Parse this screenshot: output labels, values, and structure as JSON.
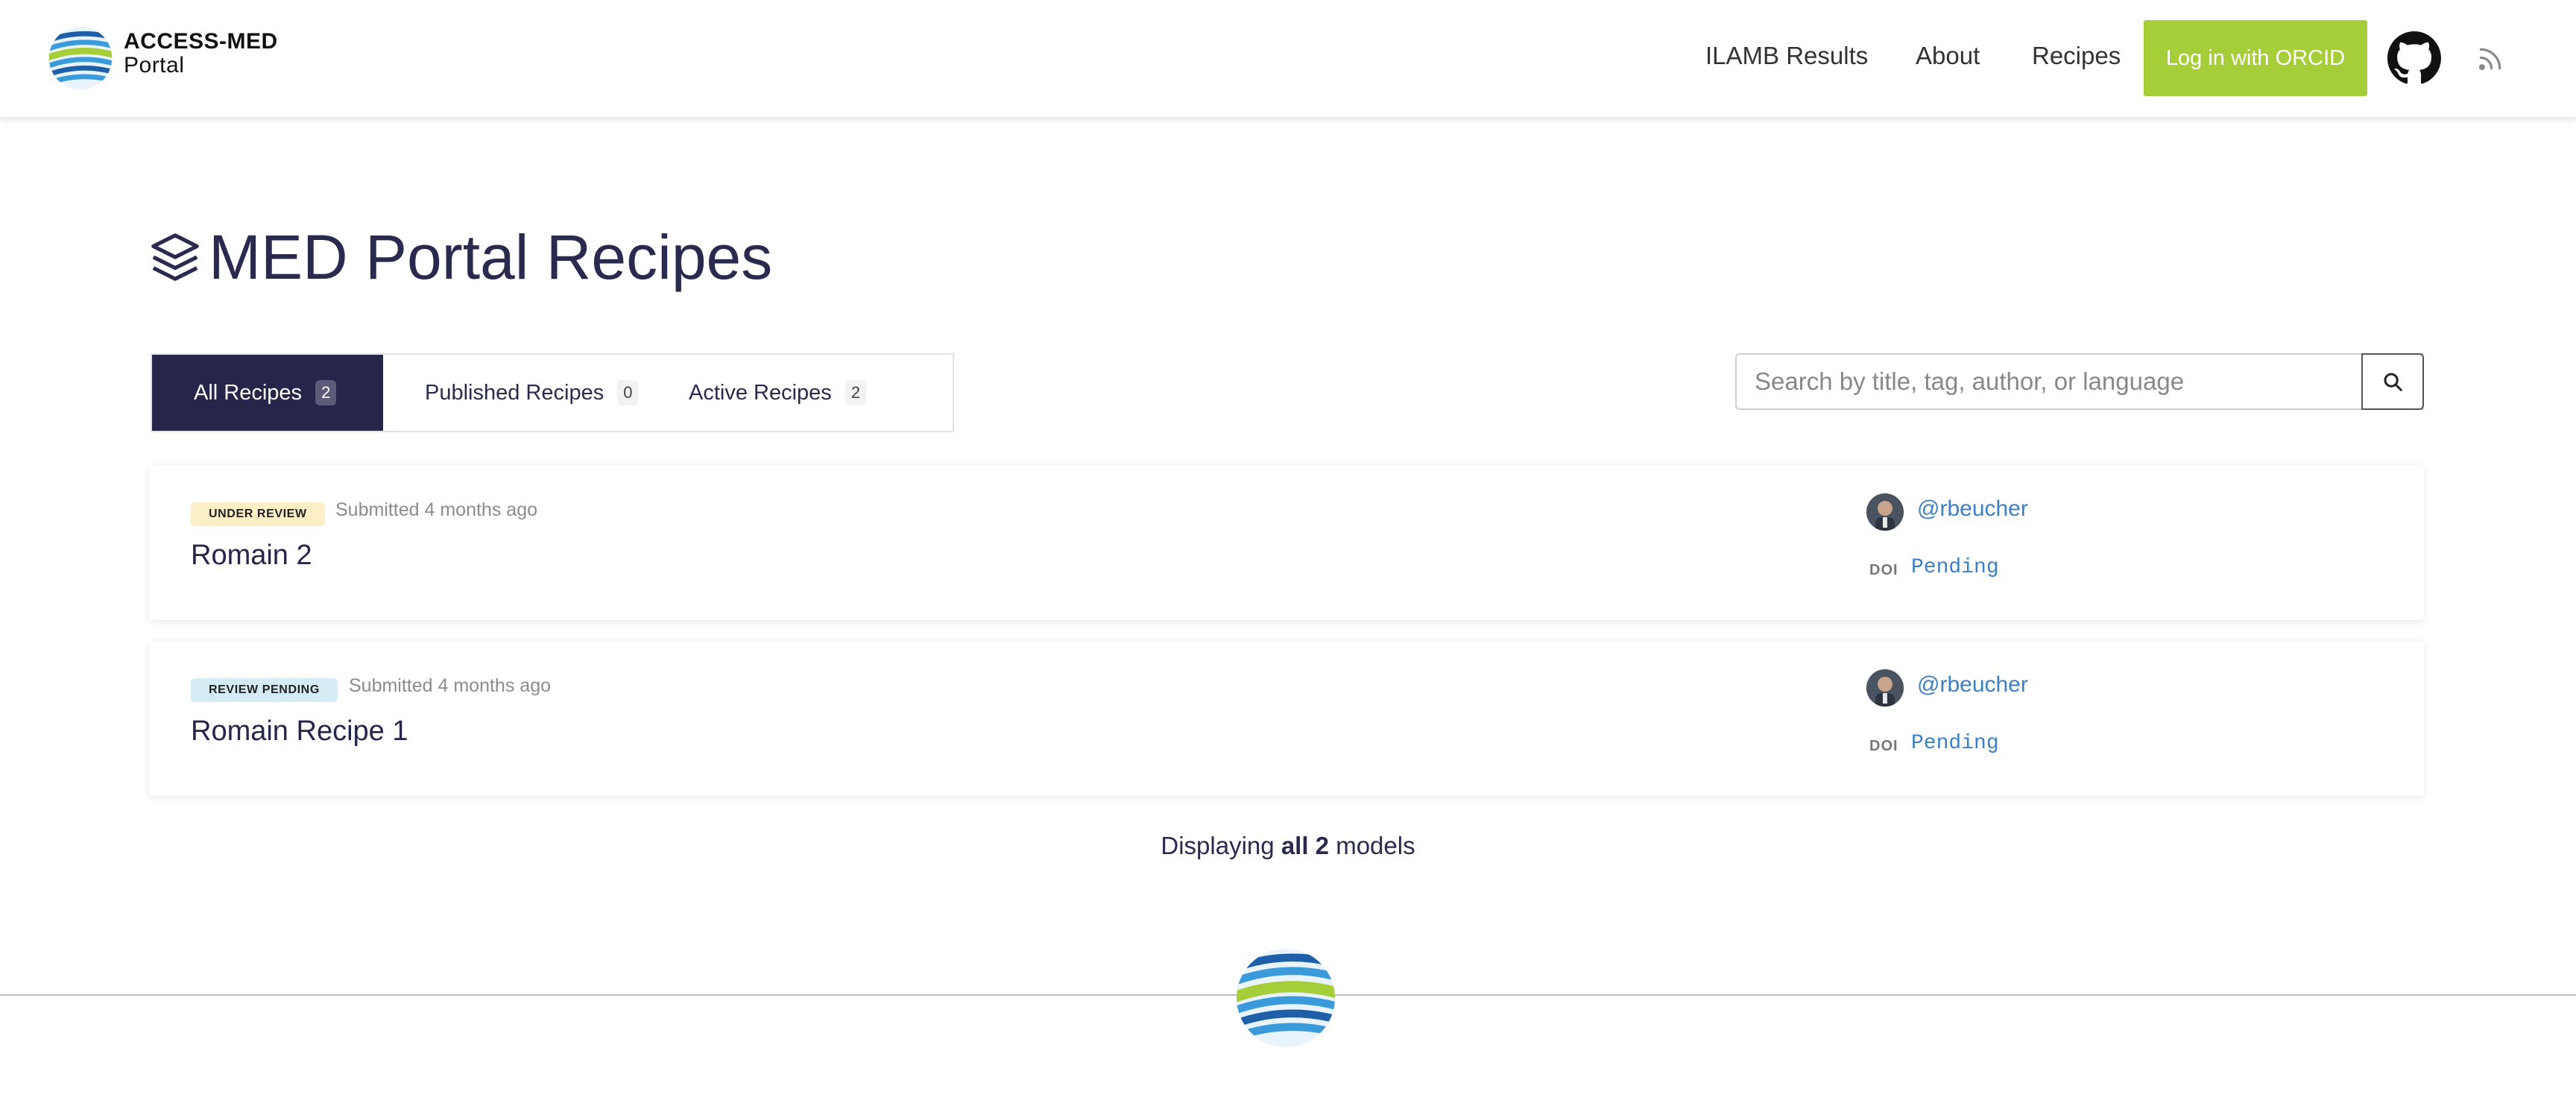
{
  "header": {
    "brand_line1": "ACCESS-MED",
    "brand_line2": "Portal",
    "nav": [
      "ILAMB Results",
      "About",
      "Recipes"
    ],
    "login_label": "Log in with ORCID",
    "github_icon": "github-icon",
    "rss_icon": "rss-icon"
  },
  "page": {
    "title": "MED Portal Recipes",
    "title_icon": "layers-icon"
  },
  "tabs": [
    {
      "label": "All Recipes",
      "count": "2",
      "active": true
    },
    {
      "label": "Published Recipes",
      "count": "0",
      "active": false
    },
    {
      "label": "Active Recipes",
      "count": "2",
      "active": false
    }
  ],
  "search": {
    "placeholder": "Search by title, tag, author, or language",
    "value": ""
  },
  "recipes": [
    {
      "status": "UNDER REVIEW",
      "submitted": "Submitted 4 months ago",
      "title": "Romain 2",
      "author": "@rbeucher",
      "doi_label": "DOI",
      "doi": "Pending"
    },
    {
      "status": "REVIEW PENDING",
      "submitted": "Submitted 4 months ago",
      "title": "Romain Recipe 1",
      "author": "@rbeucher",
      "doi_label": "DOI",
      "doi": "Pending"
    }
  ],
  "footer_summary": {
    "prefix": "Displaying",
    "emphasis": "all 2",
    "suffix": "models"
  },
  "colors": {
    "primary": "#26254a",
    "orcid_green": "#a6ce39",
    "link_blue": "#3d7fc4",
    "badge_review": "#fcefc7",
    "badge_pending": "#d5ecf5"
  }
}
